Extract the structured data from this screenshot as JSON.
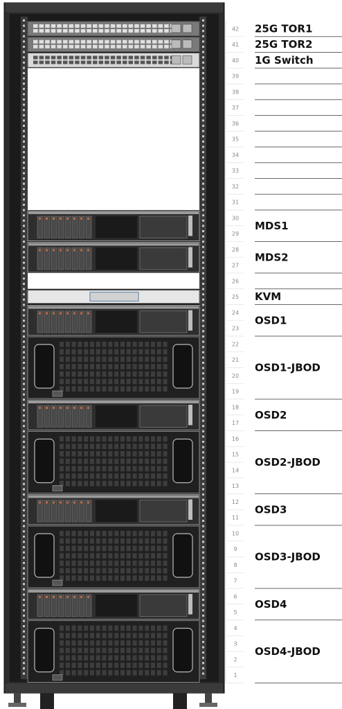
{
  "rack": {
    "units_total": 42,
    "unit_numbers": [
      "42",
      "41",
      "40",
      "39",
      "38",
      "37",
      "36",
      "35",
      "34",
      "33",
      "32",
      "31",
      "30",
      "29",
      "28",
      "27",
      "26",
      "25",
      "24",
      "23",
      "22",
      "21",
      "20",
      "19",
      "18",
      "17",
      "16",
      "15",
      "14",
      "13",
      "12",
      "11",
      "10",
      "9",
      "8",
      "7",
      "6",
      "5",
      "4",
      "3",
      "2",
      "1"
    ],
    "devices": [
      {
        "label": "25G TOR1",
        "top_u": 42,
        "size_u": 1,
        "kind": "switch25"
      },
      {
        "label": "25G TOR2",
        "top_u": 41,
        "size_u": 1,
        "kind": "switch25"
      },
      {
        "label": "1G Switch",
        "top_u": 40,
        "size_u": 1,
        "kind": "switch1g"
      },
      {
        "label": "MDS1",
        "top_u": 30,
        "size_u": 2,
        "kind": "server2u"
      },
      {
        "label": "MDS2",
        "top_u": 28,
        "size_u": 2,
        "kind": "server2u"
      },
      {
        "label": "KVM",
        "top_u": 25,
        "size_u": 1,
        "kind": "kvm"
      },
      {
        "label": "OSD1",
        "top_u": 24,
        "size_u": 2,
        "kind": "server2u"
      },
      {
        "label": "OSD1-JBOD",
        "top_u": 22,
        "size_u": 4,
        "kind": "jbod"
      },
      {
        "label": "OSD2",
        "top_u": 18,
        "size_u": 2,
        "kind": "server2u"
      },
      {
        "label": "OSD2-JBOD",
        "top_u": 16,
        "size_u": 4,
        "kind": "jbod"
      },
      {
        "label": "OSD3",
        "top_u": 12,
        "size_u": 2,
        "kind": "server2u"
      },
      {
        "label": "OSD3-JBOD",
        "top_u": 10,
        "size_u": 4,
        "kind": "jbod"
      },
      {
        "label": "OSD4",
        "top_u": 6,
        "size_u": 2,
        "kind": "server2u"
      },
      {
        "label": "OSD4-JBOD",
        "top_u": 4,
        "size_u": 4,
        "kind": "jbod"
      }
    ]
  }
}
